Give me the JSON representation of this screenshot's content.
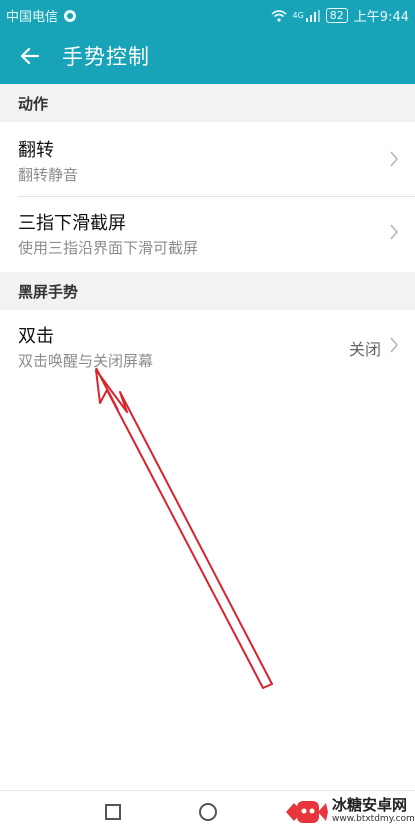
{
  "status": {
    "carrier": "中国电信",
    "network": "4G",
    "battery": "82",
    "time": "上午9:44"
  },
  "header": {
    "title": "手势控制"
  },
  "sections": [
    {
      "title": "动作",
      "items": [
        {
          "title": "翻转",
          "subtitle": "翻转静音"
        },
        {
          "title": "三指下滑截屏",
          "subtitle": "使用三指沿界面下滑可截屏"
        }
      ]
    },
    {
      "title": "黑屏手势",
      "items": [
        {
          "title": "双击",
          "subtitle": "双击唤醒与关闭屏幕",
          "value": "关闭"
        }
      ]
    }
  ],
  "watermark": {
    "name": "冰糖安卓网",
    "url": "www.btxtdmy.com"
  },
  "colors": {
    "accent": "#19a3b8",
    "annotation_arrow": "#d9232d"
  }
}
